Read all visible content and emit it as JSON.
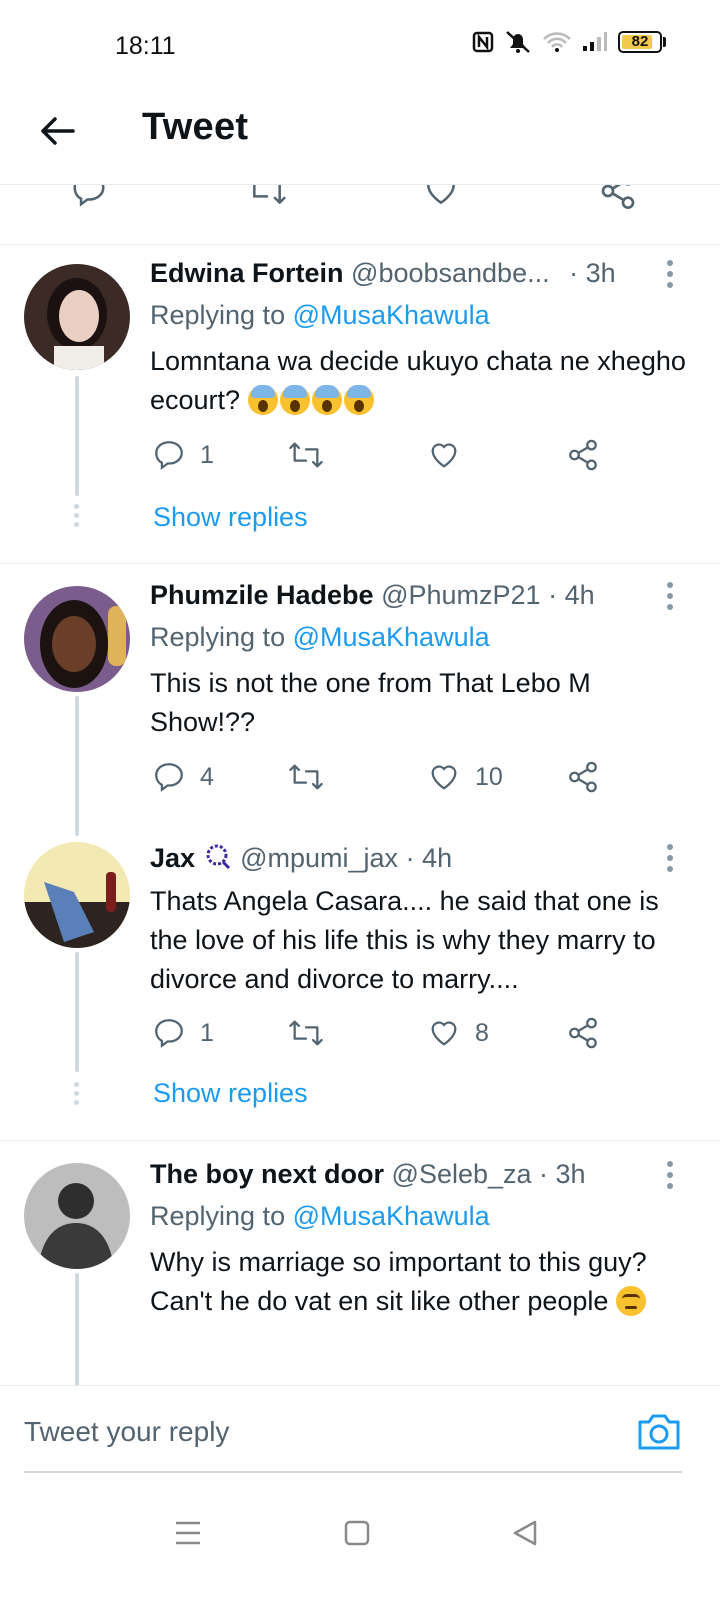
{
  "status_bar": {
    "time": "18:11",
    "battery": "82",
    "battery_level": 0.82
  },
  "header": {
    "title": "Tweet"
  },
  "composer": {
    "placeholder": "Tweet your reply"
  },
  "colors": {
    "link": "#1d9bf0",
    "secondary": "#536471",
    "line": "#cfd9de"
  },
  "replies": [
    {
      "name": "Edwina Fortein",
      "handle": "@boobsandbe...",
      "time": "· 3h",
      "replying_prefix": "Replying to ",
      "replying_to": "@MusaKhawula",
      "text": "Lomntana wa decide ukuyo chata ne xhegho ecourt?",
      "emoji": [
        "scream-face",
        "scream-face",
        "scream-face",
        "scream-face"
      ],
      "reply_count": "1",
      "retweet_count": "",
      "like_count": "",
      "show_replies": "Show replies"
    },
    {
      "name": "Phumzile Hadebe",
      "handle": "@PhumzP21",
      "time": "· 4h",
      "replying_prefix": "Replying to ",
      "replying_to": "@MusaKhawula",
      "text": "This is not the one from That Lebo M Show!??",
      "reply_count": "4",
      "retweet_count": "",
      "like_count": "10"
    },
    {
      "name": "Jax",
      "name_icon": "prayer-beads-icon",
      "handle": "@mpumi_jax",
      "time": "· 4h",
      "text": "Thats Angela Casara.... he said that one is the love of his life this is why they marry to divorce and divorce to marry....",
      "reply_count": "1",
      "retweet_count": "",
      "like_count": "8",
      "show_replies": "Show replies"
    },
    {
      "name": "The boy next door",
      "handle": "@Seleb_za",
      "time": "· 3h",
      "replying_prefix": "Replying to ",
      "replying_to": "@MusaKhawula",
      "text": "Why is marriage so important to this guy? Can't he do vat en sit like other people",
      "emoji": [
        "face-with-rolling-eyes"
      ]
    }
  ]
}
